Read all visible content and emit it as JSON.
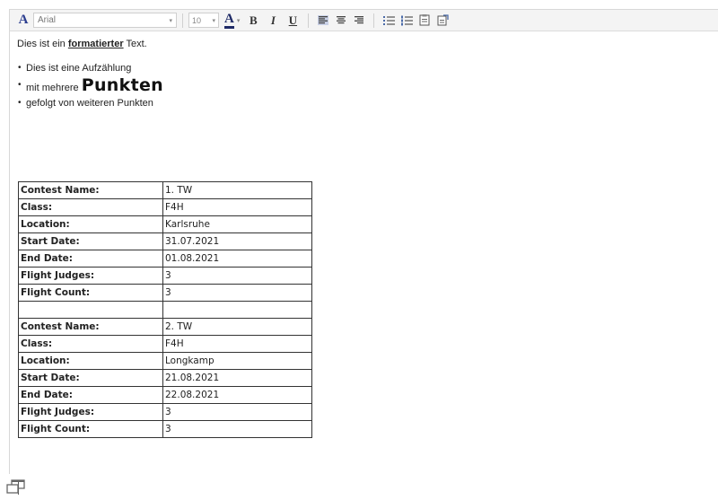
{
  "toolbar": {
    "font_family": "Arial",
    "font_size": "10",
    "font_color_glyph": "A",
    "text_color_glyph": "A",
    "bold_glyph": "B",
    "italic_glyph": "I",
    "underline_glyph": "U"
  },
  "content": {
    "intro_before": "Dies ist ein ",
    "intro_bold": "formatierter",
    "intro_after": " Text.",
    "bullets": {
      "b1": "Dies ist eine Aufzählung",
      "b2_prefix": "mit mehrere ",
      "b2_big": "Punkten",
      "b3": "gefolgt von weiteren Punkten"
    }
  },
  "table": {
    "rows": [
      {
        "k": "Contest Name:",
        "v": "1. TW"
      },
      {
        "k": "Class:",
        "v": "F4H"
      },
      {
        "k": "Location:",
        "v": "Karlsruhe"
      },
      {
        "k": "Start Date:",
        "v": "31.07.2021"
      },
      {
        "k": "End Date:",
        "v": "01.08.2021"
      },
      {
        "k": "Flight Judges:",
        "v": "3"
      },
      {
        "k": "Flight Count:",
        "v": "3"
      },
      {
        "k": "",
        "v": ""
      },
      {
        "k": "Contest Name:",
        "v": "2. TW"
      },
      {
        "k": "Class:",
        "v": "F4H"
      },
      {
        "k": "Location:",
        "v": "Longkamp"
      },
      {
        "k": "Start Date:",
        "v": "21.08.2021"
      },
      {
        "k": "End Date:",
        "v": "22.08.2021"
      },
      {
        "k": "Flight Judges:",
        "v": "3"
      },
      {
        "k": "Flight Count:",
        "v": "3"
      }
    ]
  },
  "colors": {
    "accent": "#2b3d8f",
    "toolbar_bg": "#f4f4f4",
    "border": "#333333"
  }
}
